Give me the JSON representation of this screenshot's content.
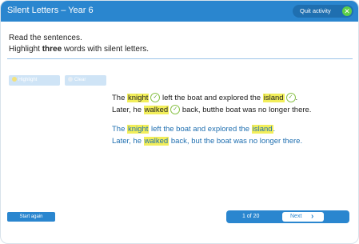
{
  "window": {
    "title": "Silent Letters – Year 6",
    "quit_label": "Quit activity",
    "quit_icon": "close-icon"
  },
  "instructions": {
    "line1": "Read the sentences.",
    "line2_pre": "Highlight ",
    "line2_bold": "three",
    "line2_post": " words with silent letters."
  },
  "toolbar": {
    "highlight_label": "Highlight",
    "clear_label": "Clear"
  },
  "sentence1": {
    "line1": {
      "t1": "The ",
      "w1": "knight",
      "t2": " left the boat and explored the ",
      "w2": "island",
      "t3": "."
    },
    "line2": {
      "t1": "Later, he ",
      "w1": "walked",
      "t2": " back, butthe boat was no longer there."
    }
  },
  "sentence2": {
    "line1": {
      "t1": "The ",
      "w1": "knight",
      "t2": " left the boat and explored the ",
      "w2": "island",
      "t3": "."
    },
    "line2": {
      "t1": "Later, he ",
      "w1": "walked",
      "t2": " back, but the boat was no longer there."
    }
  },
  "footer": {
    "start_again": "Start again",
    "page": "1 of 20",
    "next": "Next"
  },
  "colors": {
    "primary": "#2a86cf",
    "highlight": "#f2ee5a",
    "check": "#8bc34a"
  }
}
